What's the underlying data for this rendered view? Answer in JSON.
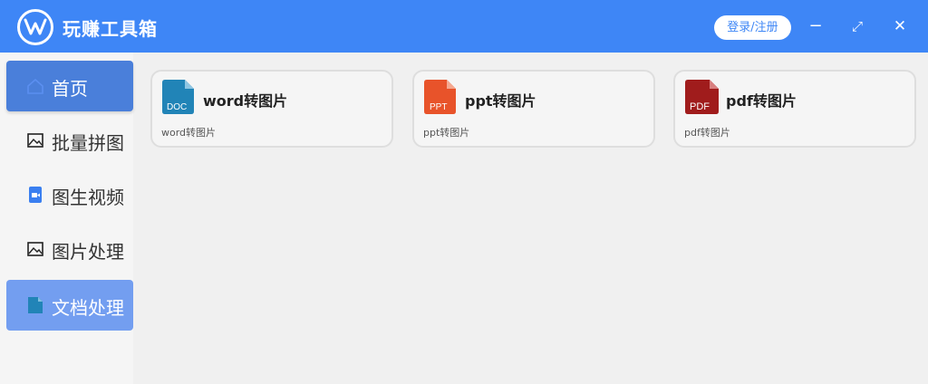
{
  "app": {
    "title": "玩赚工具箱",
    "login_label": "登录/注册"
  },
  "window_controls": {
    "minimize": "−",
    "maximize": "⤢",
    "close": "✕"
  },
  "sidebar": {
    "items": [
      {
        "label": "首页",
        "icon": "home-icon"
      },
      {
        "label": "批量拼图",
        "icon": "image-icon"
      },
      {
        "label": "图生视频",
        "icon": "video-icon"
      },
      {
        "label": "图片处理",
        "icon": "image-icon"
      },
      {
        "label": "文档处理",
        "icon": "doc-icon"
      }
    ]
  },
  "cards": [
    {
      "title": "word转图片",
      "desc": "word转图片",
      "badge": "DOC",
      "color": "#2184b7"
    },
    {
      "title": "ppt转图片",
      "desc": "ppt转图片",
      "badge": "PPT",
      "color": "#e8532a"
    },
    {
      "title": "pdf转图片",
      "desc": "pdf转图片",
      "badge": "PDF",
      "color": "#a01c1c"
    }
  ]
}
